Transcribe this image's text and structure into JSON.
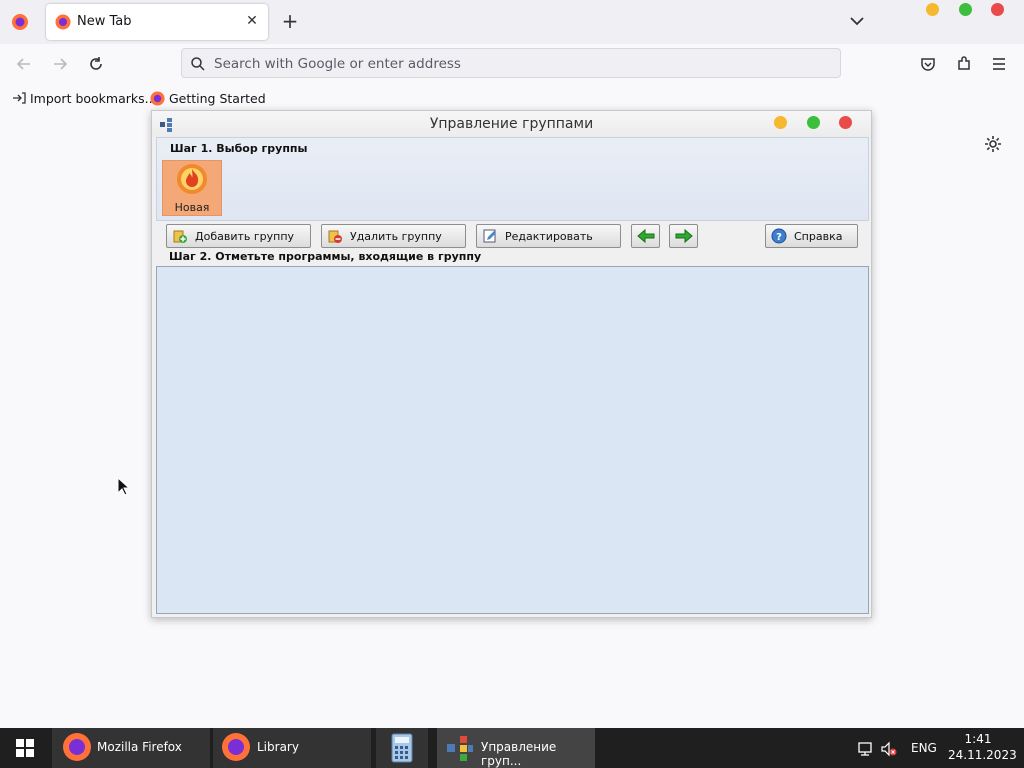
{
  "browser": {
    "tab": {
      "title": "New Tab"
    },
    "urlbar": {
      "placeholder": "Search with Google or enter address"
    },
    "bookmarks": [
      {
        "label": "Import bookmarks..."
      },
      {
        "label": "Getting Started"
      }
    ],
    "colors": {
      "minimize": "#f5b82e",
      "maximize": "#3cbf3c",
      "close": "#e94b4b"
    }
  },
  "app": {
    "title": "Управление группами",
    "step1_label": "Шаг 1. Выбор группы",
    "groups": [
      {
        "label": "Новая"
      }
    ],
    "toolbar": {
      "add_label": "Добавить группу",
      "delete_label": "Удалить группу",
      "edit_label": "Редактировать",
      "help_label": "Справка"
    },
    "step2_label": "Шаг 2. Отметьте программы, входящие в группу"
  },
  "taskbar": {
    "items": [
      {
        "label": "Mozilla Firefox"
      },
      {
        "label": "Library"
      },
      {
        "label": ""
      },
      {
        "label": "Управление груп..."
      }
    ],
    "language": "ENG",
    "time": "1:41",
    "date": "24.11.2023"
  }
}
